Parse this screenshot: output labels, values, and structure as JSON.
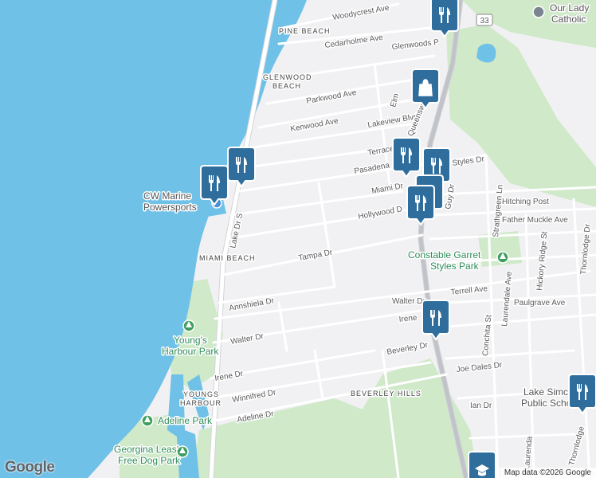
{
  "colors": {
    "water": "#6fc1e8",
    "land": "#f1f1f3",
    "park": "#cfe9c9",
    "road": "#ffffff",
    "road_casing": "#d4d4d8",
    "highway": "#c0c4c9",
    "marker": "#2f6e9c"
  },
  "street_labels": [
    {
      "id": "woodycrest",
      "text": "Woodycrest Ave"
    },
    {
      "id": "cedarholme",
      "text": "Cedarholme Ave"
    },
    {
      "id": "glenwoods",
      "text": "Glenwoods P"
    },
    {
      "id": "parkwood",
      "text": "Parkwood Ave"
    },
    {
      "id": "kenwood",
      "text": "Kenwood Ave"
    },
    {
      "id": "lakeview",
      "text": "Lakeview Blvd"
    },
    {
      "id": "elm",
      "text": "Elm"
    },
    {
      "id": "queensway",
      "text": "The Queensway S"
    },
    {
      "id": "terrace",
      "text": "Terrace Dr"
    },
    {
      "id": "pasadena",
      "text": "Pasadena"
    },
    {
      "id": "styles",
      "text": "Styles Dr"
    },
    {
      "id": "miami",
      "text": "Miami Dr"
    },
    {
      "id": "hollywood",
      "text": "Hollywood D"
    },
    {
      "id": "guy",
      "text": "Guy Dr"
    },
    {
      "id": "hitching",
      "text": "Hitching Post"
    },
    {
      "id": "fathermuckle",
      "text": "Father Muckle Ave"
    },
    {
      "id": "strathgreen",
      "text": "Strathgreen Ln"
    },
    {
      "id": "hickory",
      "text": "Hickory Ridge St"
    },
    {
      "id": "thornlodge",
      "text": "Thornlodge Dr"
    },
    {
      "id": "lakedr",
      "text": "Lake Dr S"
    },
    {
      "id": "tampa",
      "text": "Tampa Dr"
    },
    {
      "id": "annshiela",
      "text": "Annshiela Dr"
    },
    {
      "id": "walter1",
      "text": "Walter Dr"
    },
    {
      "id": "walter2",
      "text": "Walter Dr"
    },
    {
      "id": "terrell",
      "text": "Terrell Ave"
    },
    {
      "id": "paulgrave",
      "text": "Paulgrave Ave"
    },
    {
      "id": "laurendale",
      "text": "Laurendale Ave"
    },
    {
      "id": "conchita",
      "text": "Conchita St"
    },
    {
      "id": "irene1",
      "text": "Irene"
    },
    {
      "id": "irene2",
      "text": "Irene Dr"
    },
    {
      "id": "beverley",
      "text": "Beverley Dr"
    },
    {
      "id": "joedales",
      "text": "Joe Dales Dr"
    },
    {
      "id": "winnifred",
      "text": "Winnifred Dr"
    },
    {
      "id": "ian",
      "text": "Ian Dr"
    },
    {
      "id": "adeline",
      "text": "Adeline Dr"
    },
    {
      "id": "laurendale2",
      "text": "Laurenda"
    },
    {
      "id": "thornlodge2",
      "text": "Thornlodge"
    },
    {
      "id": "route",
      "text": "33"
    }
  ],
  "area_labels": [
    {
      "id": "pinebeach",
      "text": "PINE BEACH"
    },
    {
      "id": "glenwood1",
      "text": "GLENWOOD"
    },
    {
      "id": "glenwood2",
      "text": "BEACH"
    },
    {
      "id": "miamibeach",
      "text": "MIAMI BEACH"
    },
    {
      "id": "youngs1",
      "text": "YOUNGS"
    },
    {
      "id": "youngs2",
      "text": "HARBOUR"
    },
    {
      "id": "beverleyhills",
      "text": "BEVERLEY HILLS"
    }
  ],
  "poi_labels": [
    {
      "id": "cwmarine1",
      "text": "CW Marine"
    },
    {
      "id": "cwmarine2",
      "text": "Powersports"
    },
    {
      "id": "constable1",
      "text": "Constable Garret"
    },
    {
      "id": "constable2",
      "text": "Styles Park"
    },
    {
      "id": "youngspark1",
      "text": "Young's"
    },
    {
      "id": "youngspark2",
      "text": "Harbour Park"
    },
    {
      "id": "adelinepark",
      "text": "Adeline Park"
    },
    {
      "id": "georgina1",
      "text": "Georgina Leash"
    },
    {
      "id": "georgina2",
      "text": "Free Dog Park"
    },
    {
      "id": "ourlady1",
      "text": "Our Lady"
    },
    {
      "id": "ourlady2",
      "text": "Catholic"
    },
    {
      "id": "lakesimcoe1",
      "text": "Lake Simc"
    },
    {
      "id": "lakesimcoe2",
      "text": "Public Scho"
    }
  ],
  "markers": [
    {
      "id": "m1",
      "type": "restaurant",
      "icon": "restaurant-icon"
    },
    {
      "id": "m2",
      "type": "shopping",
      "icon": "shopping-bag-icon"
    },
    {
      "id": "m3",
      "type": "restaurant",
      "icon": "restaurant-icon"
    },
    {
      "id": "m4",
      "type": "restaurant",
      "icon": "restaurant-icon"
    },
    {
      "id": "m5",
      "type": "restaurant",
      "icon": "restaurant-icon"
    },
    {
      "id": "m6",
      "type": "restaurant",
      "icon": "restaurant-icon"
    },
    {
      "id": "m7",
      "type": "restaurant",
      "icon": "restaurant-icon"
    },
    {
      "id": "m8",
      "type": "restaurant",
      "icon": "restaurant-icon"
    },
    {
      "id": "m9",
      "type": "restaurant",
      "icon": "restaurant-icon"
    },
    {
      "id": "m10",
      "type": "restaurant",
      "icon": "restaurant-icon"
    },
    {
      "id": "m11",
      "type": "school",
      "icon": "school-icon"
    },
    {
      "id": "m12",
      "type": "coffee",
      "icon": "coffee-icon"
    }
  ],
  "branding": {
    "logo": "Google",
    "attribution": "Map data ©2026 Google"
  }
}
